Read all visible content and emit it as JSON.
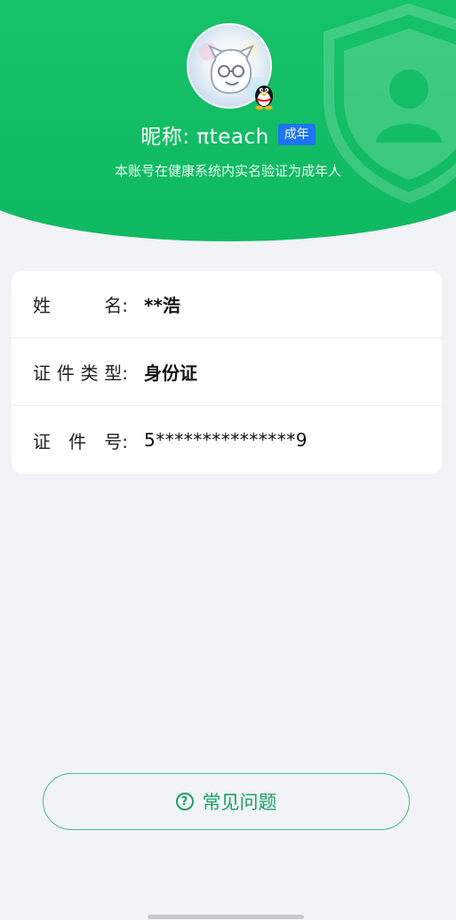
{
  "profile": {
    "nickname": "昵称: πteach",
    "age_badge": "成年",
    "verify_note": "本账号在健康系统内实名验证为成年人"
  },
  "info": {
    "rows": [
      {
        "label": [
          "姓",
          "名:"
        ],
        "value": "**浩"
      },
      {
        "label": [
          "证",
          "件",
          "类",
          "型:"
        ],
        "value": "身份证"
      },
      {
        "label": [
          "证",
          "件",
          "号:"
        ],
        "value": "5***************9"
      }
    ]
  },
  "faq": {
    "label": "常见问题",
    "icon": "help-circle-icon"
  },
  "colors": {
    "brand_green": "#16c26a",
    "badge_blue": "#1e74f5"
  }
}
